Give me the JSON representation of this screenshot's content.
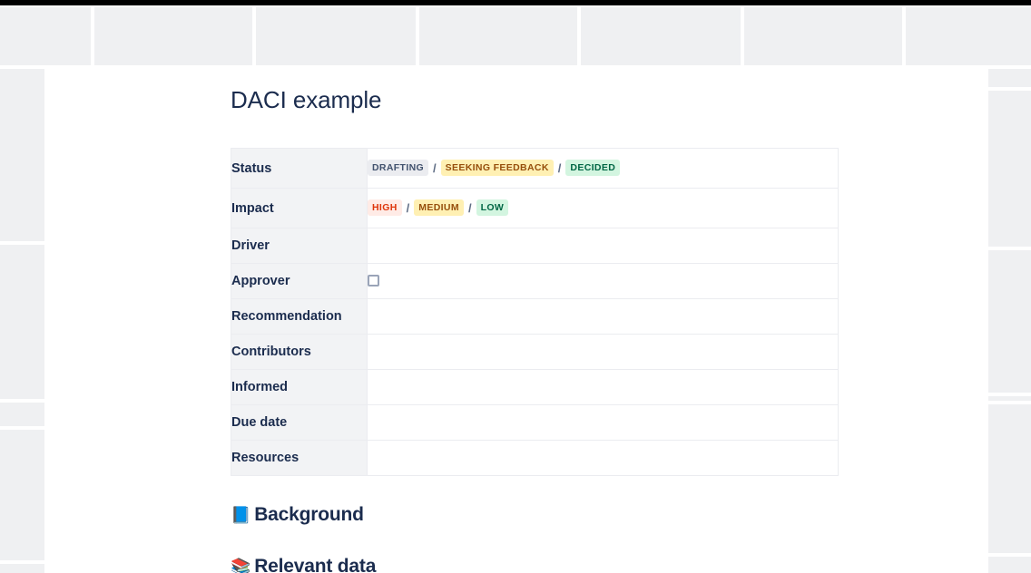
{
  "document": {
    "title": "DACI example"
  },
  "table": {
    "rows": [
      {
        "label": "Status",
        "type": "badges",
        "badges": [
          {
            "text": "DRAFTING",
            "style": "gray"
          },
          {
            "text": "SEEKING FEEDBACK",
            "style": "orange"
          },
          {
            "text": "DECIDED",
            "style": "green"
          }
        ],
        "separator": "/"
      },
      {
        "label": "Impact",
        "type": "badges",
        "badges": [
          {
            "text": "HIGH",
            "style": "red"
          },
          {
            "text": "MEDIUM",
            "style": "yellow"
          },
          {
            "text": "LOW",
            "style": "green"
          }
        ],
        "separator": "/"
      },
      {
        "label": "Driver",
        "type": "empty",
        "value": ""
      },
      {
        "label": "Approver",
        "type": "checkbox",
        "value": "",
        "checked": false
      },
      {
        "label": "Recommendation",
        "type": "empty",
        "value": ""
      },
      {
        "label": "Contributors",
        "type": "empty",
        "value": ""
      },
      {
        "label": "Informed",
        "type": "empty",
        "value": ""
      },
      {
        "label": "Due date",
        "type": "empty",
        "value": ""
      },
      {
        "label": "Resources",
        "type": "empty",
        "value": ""
      }
    ]
  },
  "sections": [
    {
      "emoji": "📘",
      "emoji_name": "blue-book-emoji",
      "title": "Background"
    },
    {
      "emoji": "📚",
      "emoji_name": "books-emoji",
      "title": "Relevant data"
    }
  ],
  "colors": {
    "title_text": "#1b2c4e",
    "label_cell_bg": "#f2f3f5",
    "table_border": "#ebecf0",
    "backdrop_block": "#eff0f2",
    "topbar": "#000000",
    "badge_gray_bg": "#ebecf0",
    "badge_gray_text": "#42526e",
    "badge_orange_bg": "#fff0b3",
    "badge_orange_text": "#974f0c",
    "badge_green_bg": "#d3f5e0",
    "badge_green_text": "#006644",
    "badge_red_bg": "#ffebe6",
    "badge_red_text": "#de350b"
  }
}
